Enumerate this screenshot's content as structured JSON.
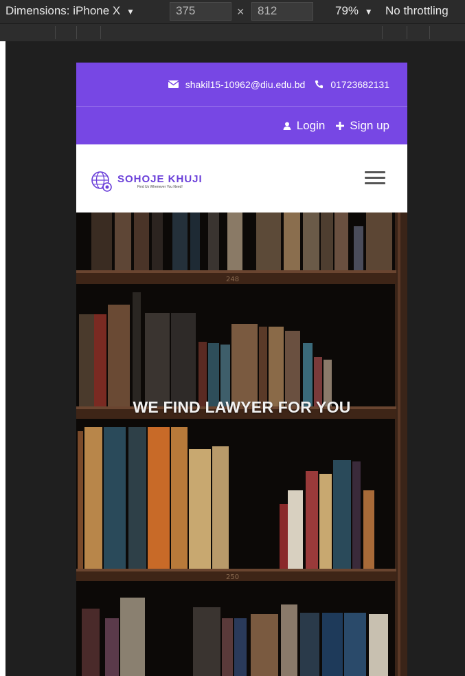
{
  "devtools": {
    "dimensions_label": "Dimensions: iPhone X",
    "width": "375",
    "height": "812",
    "zoom": "79%",
    "throttling": "No throttling"
  },
  "topbar": {
    "email": "shakil15-10962@diu.edu.bd",
    "phone": "01723682131",
    "login_label": "Login",
    "signup_label": "Sign up"
  },
  "brand": {
    "name": "SOHOJE KHUJI",
    "tagline": "Find Us Whenever You Need!"
  },
  "hero": {
    "title": "WE FIND LAWYER FOR YOU",
    "shelf_labels": [
      "248",
      "250"
    ]
  },
  "colors": {
    "accent": "#7747e4",
    "brand_text": "#6a3fd9"
  }
}
